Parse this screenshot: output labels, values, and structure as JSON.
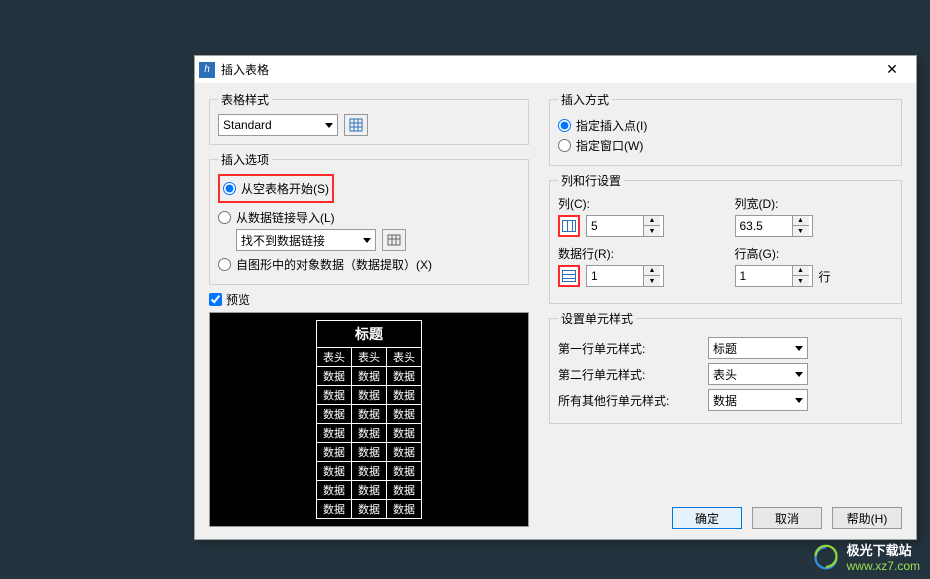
{
  "dialog": {
    "title": "插入表格"
  },
  "left": {
    "tableStyle": {
      "legend": "表格样式",
      "value": "Standard"
    },
    "insertOptions": {
      "legend": "插入选项",
      "opt1": "从空表格开始(S)",
      "opt2": "从数据链接导入(L)",
      "datalink_value": "找不到数据链接",
      "opt3": "自图形中的对象数据（数据提取）(X)"
    },
    "preview": {
      "label": "预览",
      "title": "标题",
      "header": "表头",
      "cell": "数据"
    }
  },
  "right": {
    "insertMode": {
      "legend": "插入方式",
      "opt1": "指定插入点(I)",
      "opt2": "指定窗口(W)"
    },
    "colrow": {
      "legend": "列和行设置",
      "cols_label": "列(C):",
      "cols_value": "5",
      "colw_label": "列宽(D):",
      "colw_value": "63.5",
      "rows_label": "数据行(R):",
      "rows_value": "1",
      "rowh_label": "行高(G):",
      "rowh_value": "1",
      "rowh_unit": "行"
    },
    "cellStyle": {
      "legend": "设置单元样式",
      "row1_label": "第一行单元样式:",
      "row1_value": "标题",
      "row2_label": "第二行单元样式:",
      "row2_value": "表头",
      "other_label": "所有其他行单元样式:",
      "other_value": "数据"
    }
  },
  "buttons": {
    "ok": "确定",
    "cancel": "取消",
    "help": "帮助(H)"
  },
  "watermark": {
    "text": "极光下载站",
    "url": "www.xz7.com"
  }
}
